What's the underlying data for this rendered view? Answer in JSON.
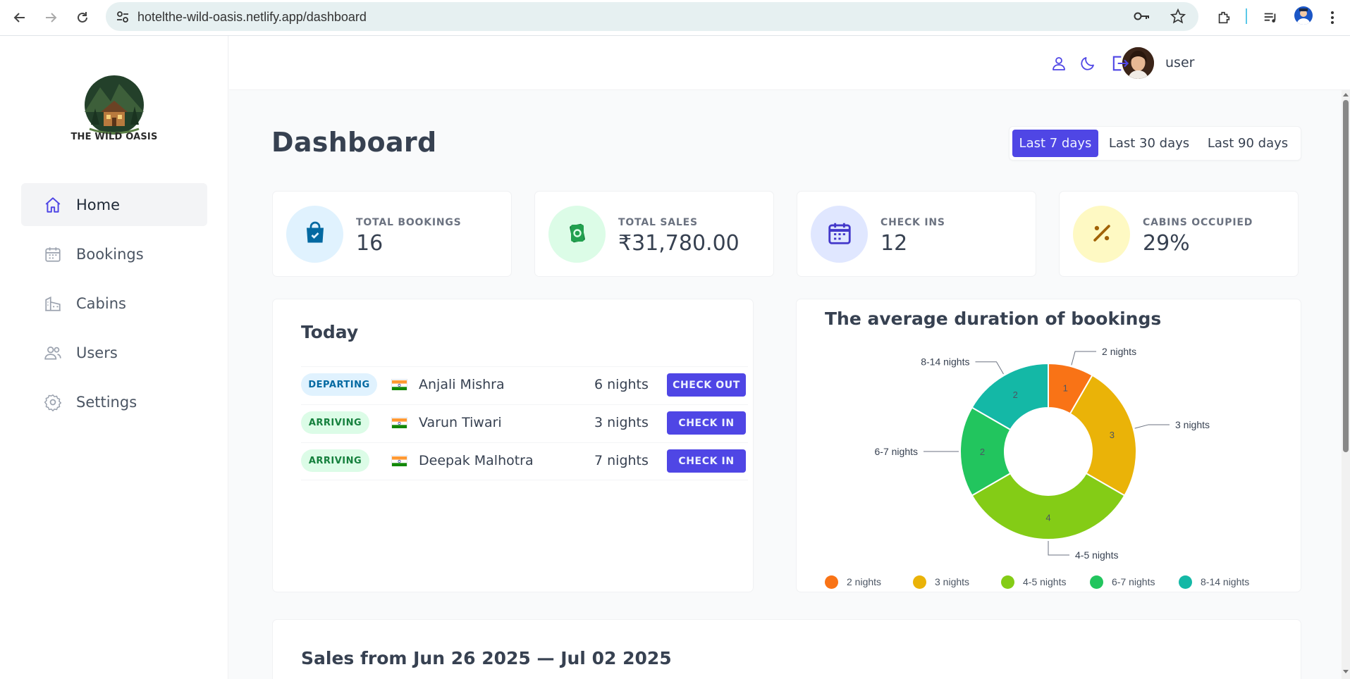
{
  "browser": {
    "url": "hotelthe-wild-oasis.netlify.app/dashboard",
    "icons": [
      "back-icon",
      "forward-icon",
      "reload-icon",
      "site-info-icon",
      "password-key-icon",
      "bookmark-star-icon",
      "extensions-icon",
      "reading-list-icon",
      "profile-icon",
      "menu-icon"
    ]
  },
  "sidebar": {
    "logo_text": "THE WILD OASIS",
    "items": [
      {
        "label": "Home",
        "icon": "home-icon",
        "active": true
      },
      {
        "label": "Bookings",
        "icon": "calendar-icon",
        "active": false
      },
      {
        "label": "Cabins",
        "icon": "cabin-icon",
        "active": false
      },
      {
        "label": "Users",
        "icon": "users-icon",
        "active": false
      },
      {
        "label": "Settings",
        "icon": "gear-icon",
        "active": false
      }
    ]
  },
  "header": {
    "username": "user",
    "icons": [
      "account-icon",
      "dark-mode-moon-icon",
      "logout-icon"
    ]
  },
  "dashboard": {
    "title": "Dashboard",
    "filters": [
      {
        "label": "Last 7 days",
        "active": true
      },
      {
        "label": "Last 30 days",
        "active": false
      },
      {
        "label": "Last 90 days",
        "active": false
      }
    ],
    "stats": [
      {
        "label": "TOTAL BOOKINGS",
        "value": "16",
        "icon": "shopping-bag-icon",
        "bg": "#e0f2fe",
        "fg": "#0369a1"
      },
      {
        "label": "TOTAL SALES",
        "value": "₹31,780.00",
        "icon": "banknotes-icon",
        "bg": "#dcfce7",
        "fg": "#15803d"
      },
      {
        "label": "CHECK INS",
        "value": "12",
        "icon": "calendar-days-icon",
        "bg": "#e0e7ff",
        "fg": "#4338ca"
      },
      {
        "label": "CABINS OCCUPIED",
        "value": "29%",
        "icon": "percent-icon",
        "bg": "#fef9c3",
        "fg": "#a16207"
      }
    ]
  },
  "today": {
    "title": "Today",
    "rows": [
      {
        "status": "DEPARTING",
        "guest": "Anjali Mishra",
        "nights": "6 nights",
        "action": "CHECK OUT"
      },
      {
        "status": "ARRIVING",
        "guest": "Varun Tiwari",
        "nights": "3 nights",
        "action": "CHECK IN"
      },
      {
        "status": "ARRIVING",
        "guest": "Deepak Malhotra",
        "nights": "7 nights",
        "action": "CHECK IN"
      }
    ]
  },
  "duration_chart": {
    "title": "The average duration of bookings"
  },
  "chart_data": {
    "type": "pie",
    "title": "The average duration of bookings",
    "donut": true,
    "categories": [
      "2 nights",
      "3 nights",
      "4-5 nights",
      "6-7 nights",
      "8-14 nights"
    ],
    "values": [
      1,
      3,
      4,
      2,
      2
    ],
    "colors": [
      "#f97316",
      "#eab308",
      "#84cc16",
      "#22c55e",
      "#14b8a6"
    ],
    "legend": "bottom"
  },
  "sales": {
    "title": "Sales from Jun 26 2025 — Jul 02 2025"
  }
}
